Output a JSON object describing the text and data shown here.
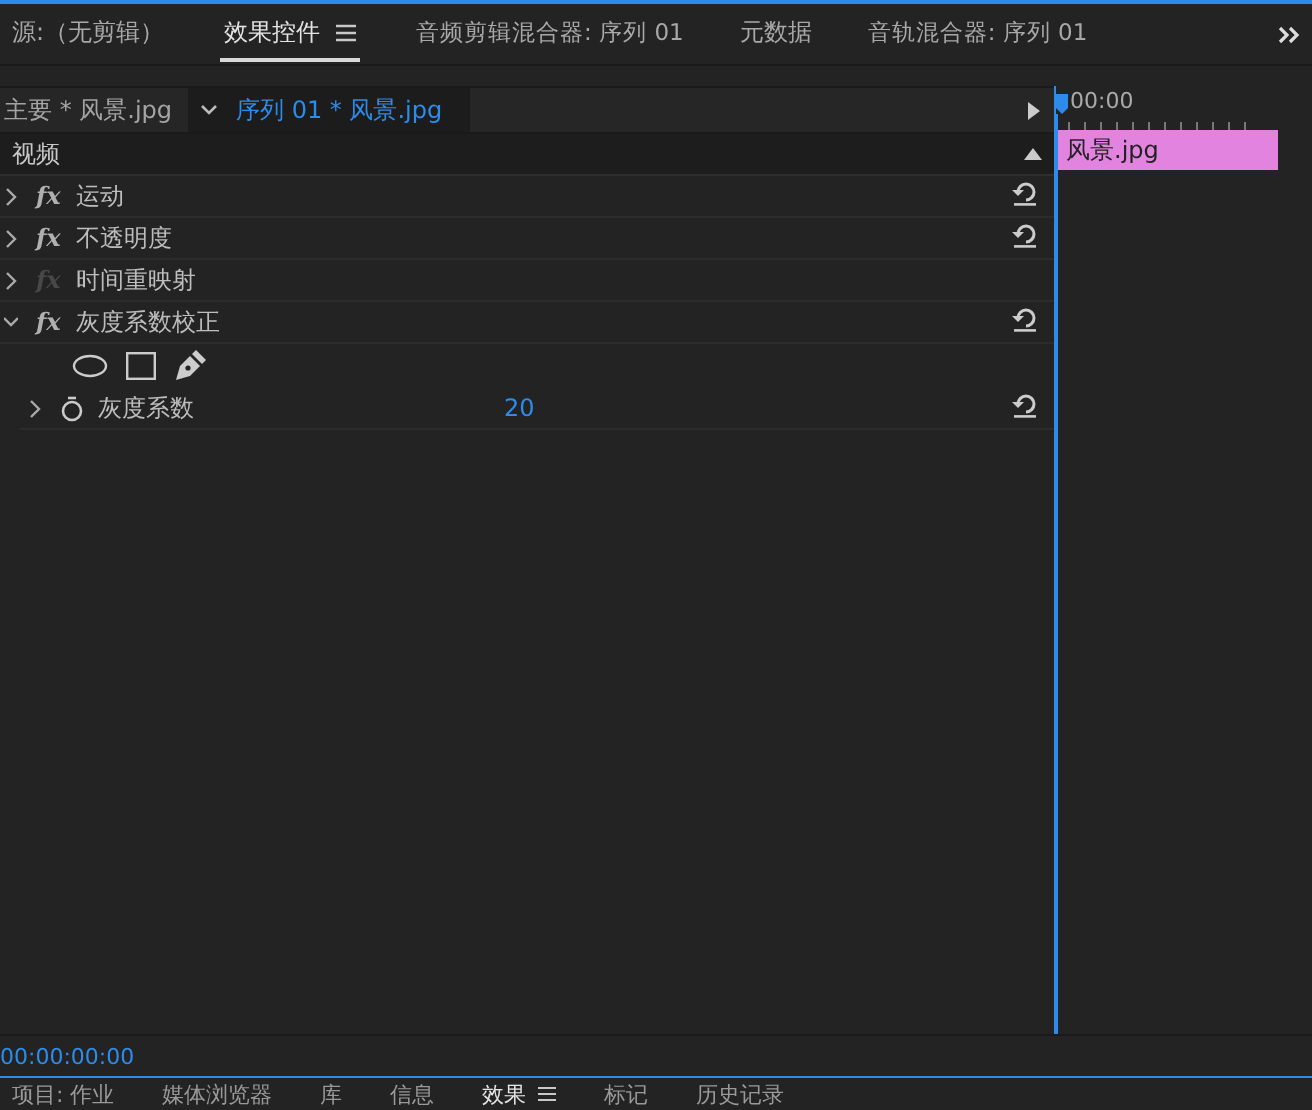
{
  "panel_tabs": [
    {
      "label": "源:（无剪辑）",
      "selected": false,
      "menu": false
    },
    {
      "label": "效果控件",
      "selected": true,
      "menu": true
    },
    {
      "label": "音频剪辑混合器: 序列 01",
      "selected": false,
      "menu": false
    },
    {
      "label": "元数据",
      "selected": false,
      "menu": false
    },
    {
      "label": "音轨混合器: 序列 01",
      "selected": false,
      "menu": false
    }
  ],
  "clip_header": {
    "master": "主要 * 风景.jpg",
    "sequence": "序列 01 * 风景.jpg"
  },
  "timeline": {
    "time": "00:00",
    "clip": {
      "name": "风景.jpg",
      "color": "#e283e0"
    }
  },
  "section": "视频",
  "effects": [
    {
      "fx": "fx",
      "name": "运动",
      "expanded": false,
      "disabled": false,
      "reset": true
    },
    {
      "fx": "fx",
      "name": "不透明度",
      "expanded": false,
      "disabled": false,
      "reset": true
    },
    {
      "fx": "fx",
      "name": "时间重映射",
      "expanded": false,
      "disabled": true,
      "reset": false
    },
    {
      "fx": "fx",
      "name": "灰度系数校正",
      "expanded": true,
      "disabled": false,
      "reset": true,
      "children": [
        {
          "kind": "mask_tools"
        },
        {
          "kind": "property",
          "name": "灰度系数",
          "value": "20",
          "expanded": false,
          "reset": true
        }
      ]
    }
  ],
  "timecode": "00:00:00:00",
  "bottom_tabs": [
    {
      "label": "项目: 作业",
      "selected": false,
      "menu": false
    },
    {
      "label": "媒体浏览器",
      "selected": false,
      "menu": false
    },
    {
      "label": "库",
      "selected": false,
      "menu": false
    },
    {
      "label": "信息",
      "selected": false,
      "menu": false
    },
    {
      "label": "效果",
      "selected": true,
      "menu": true
    },
    {
      "label": "标记",
      "selected": false,
      "menu": false
    },
    {
      "label": "历史记录",
      "selected": false,
      "menu": false
    }
  ]
}
